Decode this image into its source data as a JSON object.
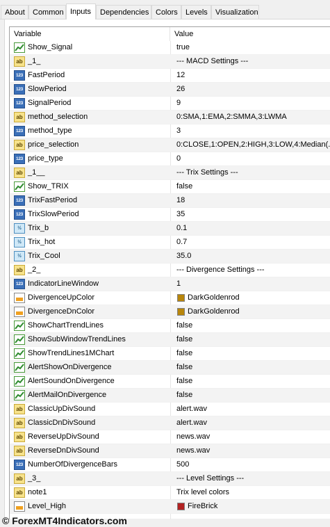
{
  "tabs": [
    "About",
    "Common",
    "Inputs",
    "Dependencies",
    "Colors",
    "Levels",
    "Visualization"
  ],
  "active_tab": "Inputs",
  "table": {
    "columns": [
      "Variable",
      "Value"
    ],
    "rows": [
      {
        "icon": "bool",
        "name": "Show_Signal",
        "value": "true"
      },
      {
        "icon": "string",
        "name": "_1_",
        "value": "--- MACD Settings ---"
      },
      {
        "icon": "int",
        "name": "FastPeriod",
        "value": "12"
      },
      {
        "icon": "int",
        "name": "SlowPeriod",
        "value": "26"
      },
      {
        "icon": "int",
        "name": "SignalPeriod",
        "value": "9"
      },
      {
        "icon": "string",
        "name": "method_selection",
        "value": "0:SMA,1:EMA,2:SMMA,3:LWMA"
      },
      {
        "icon": "int",
        "name": "method_type",
        "value": "3"
      },
      {
        "icon": "string",
        "name": "price_selection",
        "value": "0:CLOSE,1:OPEN,2:HIGH,3:LOW,4:Median(..."
      },
      {
        "icon": "int",
        "name": "price_type",
        "value": "0"
      },
      {
        "icon": "string",
        "name": "_1__",
        "value": "--- Trix Settings ---"
      },
      {
        "icon": "bool",
        "name": "Show_TRIX",
        "value": "false"
      },
      {
        "icon": "int",
        "name": "TrixFastPeriod",
        "value": "18"
      },
      {
        "icon": "int",
        "name": "TrixSlowPeriod",
        "value": "35"
      },
      {
        "icon": "double",
        "name": "Trix_b",
        "value": "0.1"
      },
      {
        "icon": "double",
        "name": "Trix_hot",
        "value": "0.7"
      },
      {
        "icon": "double",
        "name": "Trix_Cool",
        "value": "35.0"
      },
      {
        "icon": "string",
        "name": "_2_",
        "value": "--- Divergence Settings ---"
      },
      {
        "icon": "int",
        "name": "IndicatorLineWindow",
        "value": "1"
      },
      {
        "icon": "color",
        "name": "DivergenceUpColor",
        "value": "DarkGoldenrod",
        "swatch": "#b8860b"
      },
      {
        "icon": "color",
        "name": "DivergenceDnColor",
        "value": "DarkGoldenrod",
        "swatch": "#b8860b"
      },
      {
        "icon": "bool",
        "name": "ShowChartTrendLines",
        "value": "false"
      },
      {
        "icon": "bool",
        "name": "ShowSubWindowTrendLines",
        "value": "false"
      },
      {
        "icon": "bool",
        "name": "ShowTrendLines1MChart",
        "value": "false"
      },
      {
        "icon": "bool",
        "name": "AlertShowOnDivergence",
        "value": "false"
      },
      {
        "icon": "bool",
        "name": "AlertSoundOnDivergence",
        "value": "false"
      },
      {
        "icon": "bool",
        "name": "AlertMailOnDivergence",
        "value": "false"
      },
      {
        "icon": "string",
        "name": "ClassicUpDivSound",
        "value": "alert.wav"
      },
      {
        "icon": "string",
        "name": "ClassicDnDivSound",
        "value": "alert.wav"
      },
      {
        "icon": "string",
        "name": "ReverseUpDivSound",
        "value": "news.wav"
      },
      {
        "icon": "string",
        "name": "ReverseDnDivSound",
        "value": "news.wav"
      },
      {
        "icon": "int",
        "name": "NumberOfDivergenceBars",
        "value": "500"
      },
      {
        "icon": "string",
        "name": "_3_",
        "value": "--- Level Settings ---"
      },
      {
        "icon": "string",
        "name": "note1",
        "value": "Trix level colors"
      },
      {
        "icon": "color",
        "name": "Level_High",
        "value": "FireBrick",
        "swatch": "#b22222"
      }
    ]
  },
  "icon_glyphs": {
    "string": "ab",
    "int": "123",
    "double": "½"
  },
  "colors": {
    "bool_line": "#2e8b2e",
    "grid_border": "#a0a0a0",
    "alt_row": "#f3f3f3"
  },
  "footer": "© ForexMT4Indicators.com"
}
